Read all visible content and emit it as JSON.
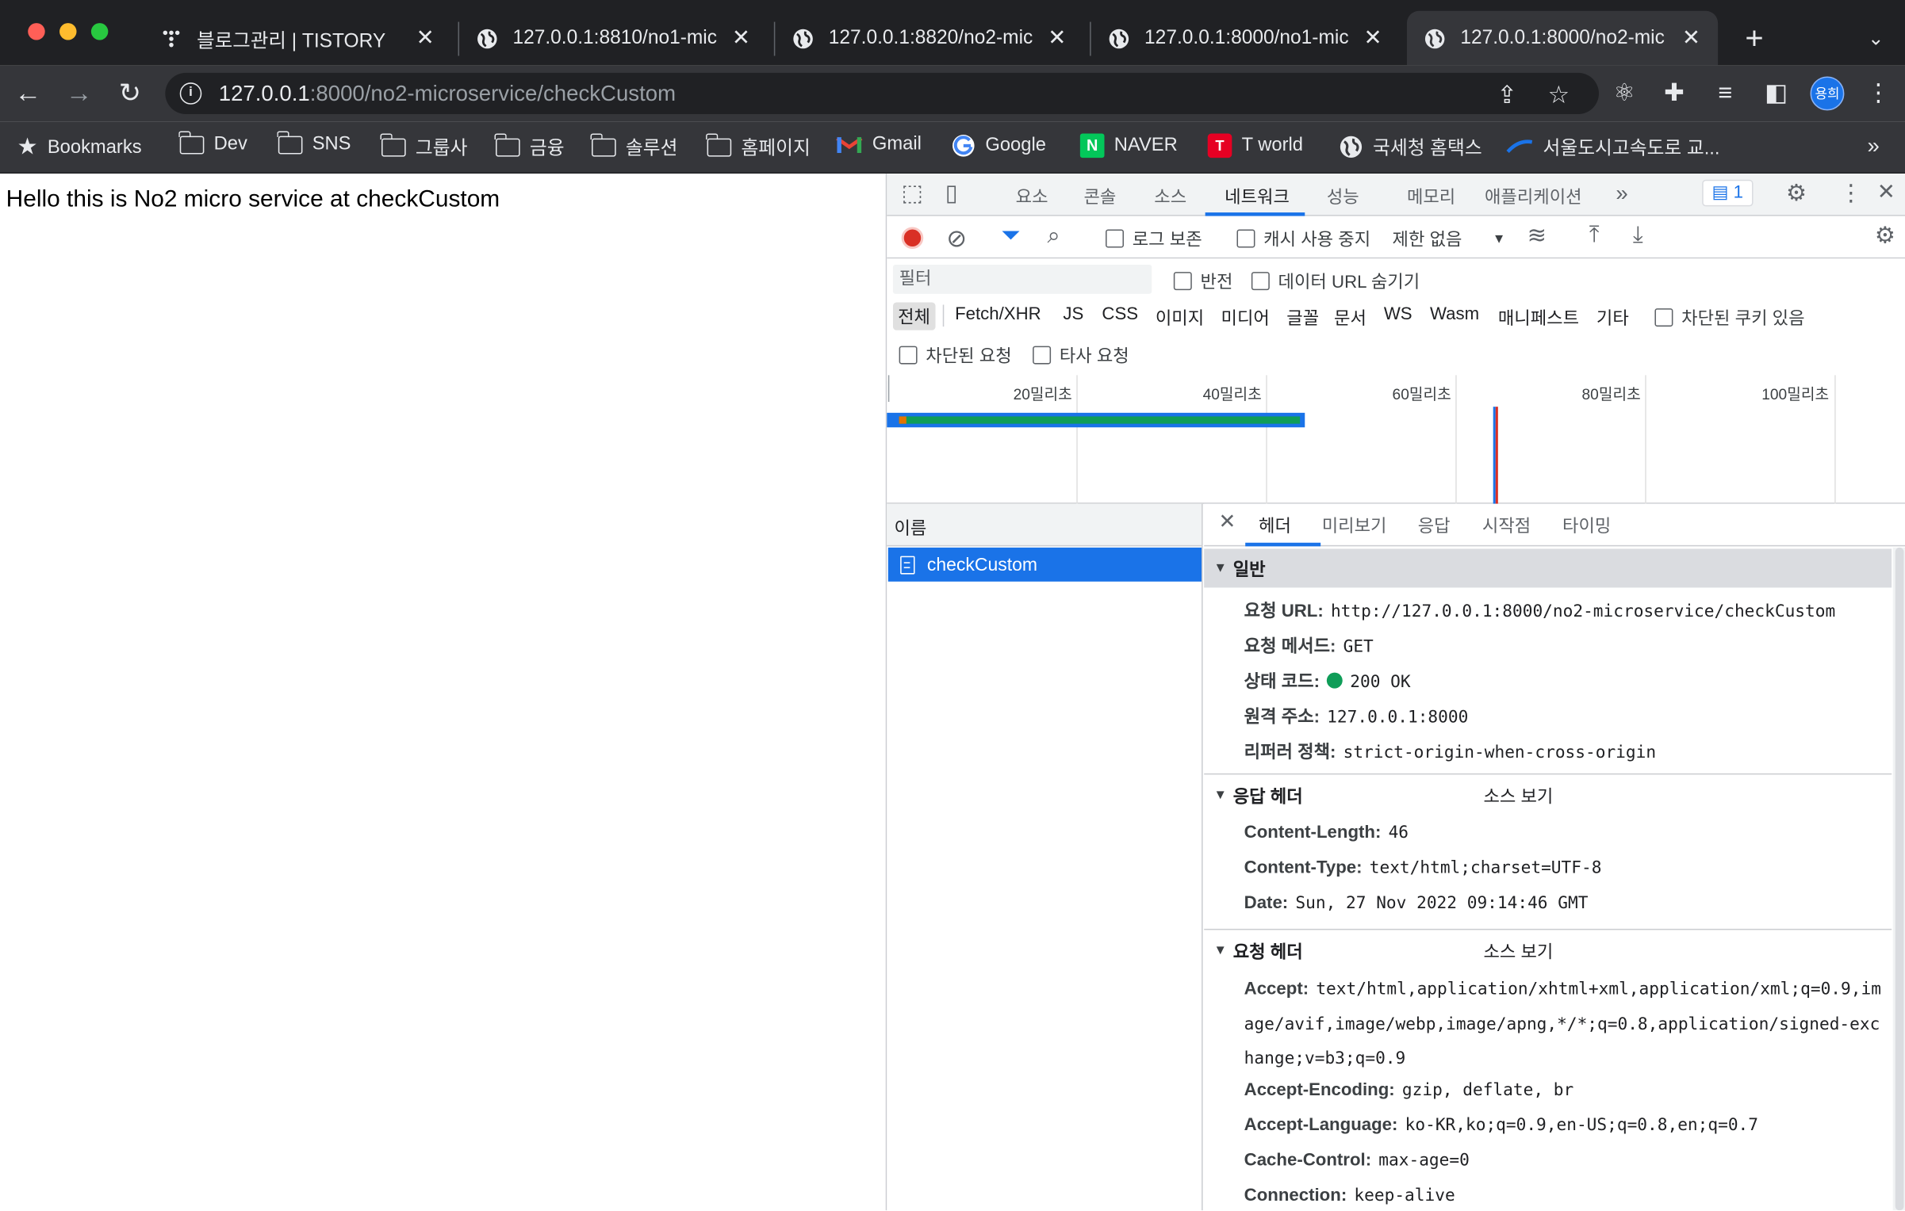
{
  "tabs": [
    {
      "title": "블로그관리 | TISTORY",
      "icon": "tistory-icon"
    },
    {
      "title": "127.0.0.1:8810/no1-mic",
      "icon": "globe-icon"
    },
    {
      "title": "127.0.0.1:8820/no2-mic",
      "icon": "globe-icon"
    },
    {
      "title": "127.0.0.1:8000/no1-mic",
      "icon": "globe-icon"
    },
    {
      "title": "127.0.0.1:8000/no2-mic",
      "icon": "globe-icon",
      "active": true
    }
  ],
  "omnibox": {
    "host": "127.0.0.1",
    "rest": ":8000/no2-microservice/checkCustom"
  },
  "profile": {
    "initials": "용희"
  },
  "bookmarks": [
    {
      "label": "Bookmarks",
      "icon": "star-icon"
    },
    {
      "label": "Dev",
      "icon": "folder-icon"
    },
    {
      "label": "SNS",
      "icon": "folder-icon"
    },
    {
      "label": "그룹사",
      "icon": "folder-icon"
    },
    {
      "label": "금융",
      "icon": "folder-icon"
    },
    {
      "label": "솔루션",
      "icon": "folder-icon"
    },
    {
      "label": "홈페이지",
      "icon": "folder-icon"
    },
    {
      "label": "Gmail",
      "icon": "gmail-icon"
    },
    {
      "label": "Google",
      "icon": "google-icon"
    },
    {
      "label": "NAVER",
      "icon": "naver-icon"
    },
    {
      "label": "T world",
      "icon": "tworld-icon"
    },
    {
      "label": "국세청 홈택스",
      "icon": "globe-icon"
    },
    {
      "label": "서울도시고속도로 교...",
      "icon": "seoul-icon"
    }
  ],
  "bookmarks_more": "»",
  "page": {
    "text": "Hello this is No2 micro service at checkCustom"
  },
  "devtools": {
    "tabs": [
      "요소",
      "콘솔",
      "소스",
      "네트워크",
      "성능",
      "메모리",
      "애플리케이션"
    ],
    "more": "»",
    "issues_count": "1",
    "controls": {
      "preserve_log": "로그 보존",
      "disable_cache": "캐시 사용 중지",
      "throttle": "제한 없음"
    },
    "filter": {
      "placeholder": "필터",
      "invert": "반전",
      "hide_data_urls": "데이터 URL 숨기기",
      "types": [
        "전체",
        "Fetch/XHR",
        "JS",
        "CSS",
        "이미지",
        "미디어",
        "글꼴",
        "문서",
        "WS",
        "Wasm",
        "매니페스트",
        "기타"
      ],
      "blocked_cookies": "차단된 쿠키 있음",
      "blocked_requests": "차단된 요청",
      "third_party": "타사 요청"
    },
    "timeline": {
      "ticks": [
        "20밀리초",
        "40밀리초",
        "60밀리초",
        "80밀리초",
        "100밀리초"
      ]
    },
    "name_header": "이름",
    "requests": [
      {
        "name": "checkCustom"
      }
    ],
    "detail_tabs": [
      "헤더",
      "미리보기",
      "응답",
      "시작점",
      "타이밍"
    ],
    "general": {
      "title": "일반",
      "rows": [
        {
          "k": "요청 URL:",
          "v": "http://127.0.0.1:8000/no2-microservice/checkCustom"
        },
        {
          "k": "요청 메서드:",
          "v": "GET"
        },
        {
          "k": "상태 코드:",
          "v": "200 OK"
        },
        {
          "k": "원격 주소:",
          "v": "127.0.0.1:8000"
        },
        {
          "k": "리퍼러 정책:",
          "v": "strict-origin-when-cross-origin"
        }
      ]
    },
    "response_headers": {
      "title": "응답 헤더",
      "view_source": "소스 보기",
      "rows": [
        {
          "k": "Content-Length:",
          "v": "46"
        },
        {
          "k": "Content-Type:",
          "v": "text/html;charset=UTF-8"
        },
        {
          "k": "Date:",
          "v": "Sun, 27 Nov 2022 09:14:46 GMT"
        }
      ]
    },
    "request_headers": {
      "title": "요청 헤더",
      "view_source": "소스 보기",
      "accept": {
        "k": "Accept:",
        "v": "text/html,application/xhtml+xml,application/xml;q=0.9,image/avif,image/webp,image/apng,*/*;q=0.8,application/signed-exchange;v=b3;q=0.9"
      },
      "rows": [
        {
          "k": "Accept-Encoding:",
          "v": "gzip, deflate, br"
        },
        {
          "k": "Accept-Language:",
          "v": "ko-KR,ko;q=0.9,en-US;q=0.8,en;q=0.7"
        },
        {
          "k": "Cache-Control:",
          "v": "max-age=0"
        },
        {
          "k": "Connection:",
          "v": "keep-alive"
        }
      ]
    }
  },
  "colors": {
    "accent": "#1a73e8",
    "record": "#d93025",
    "status_ok": "#0f9d58"
  }
}
